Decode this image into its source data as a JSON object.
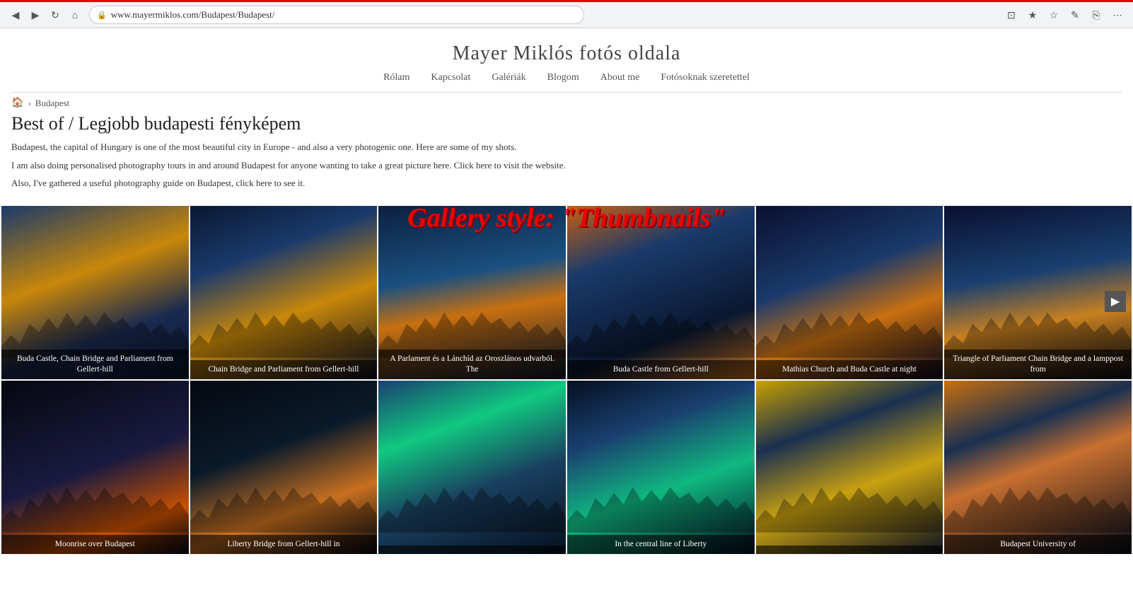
{
  "browser": {
    "url": "www.mayermiklos.com/Budapest/Budapest/",
    "back_label": "◀",
    "forward_label": "▶",
    "reload_label": "↻",
    "home_label": "⌂",
    "bookmark_label": "★",
    "star_label": "☆",
    "pen_label": "✎",
    "share_label": "⎘",
    "menu_label": "⋯"
  },
  "site": {
    "title": "Mayer Miklós fotós oldala",
    "nav": {
      "items": [
        {
          "label": "Rólam"
        },
        {
          "label": "Kapcsolat"
        },
        {
          "label": "Galériák"
        },
        {
          "label": "Blogom"
        },
        {
          "label": "About me"
        },
        {
          "label": "Fotósoknak szeretettel"
        }
      ]
    }
  },
  "breadcrumb": {
    "home_icon": "🏠",
    "separator": "›",
    "current": "Budapest"
  },
  "gallery_overlay": {
    "title": "Gallery style: \"Thumbnails\""
  },
  "page": {
    "heading": "Best of / Legjobb budapesti fényképem",
    "desc1": "Budapest, the capital of Hungary is one of the most beautiful city in Europe - and also a very photogenic one. Here are some of my shots.",
    "desc2": "I am also doing personalised photography tours in and around Budapest for anyone wanting to take a great picture here. Click here to visit the website.",
    "desc3": "Also, I've gathered a useful photography guide on Budapest, click here to see it."
  },
  "scroll_arrow": "▶",
  "gallery": {
    "items": [
      {
        "caption": "Buda Castle, Chain Bridge and Parliament from Gellert-hill",
        "photo_class": "photo-1"
      },
      {
        "caption": "Chain Bridge and Parliament from Gellert-hill",
        "photo_class": "photo-2"
      },
      {
        "caption": "A Parlament és a Lánchíd az Oroszlános udvarból. The",
        "photo_class": "photo-3"
      },
      {
        "caption": "Buda Castle from Gellert-hill",
        "photo_class": "photo-4"
      },
      {
        "caption": "Mathias Church and Buda Castle at night",
        "photo_class": "photo-5"
      },
      {
        "caption": "Triangle of Parliament Chain Bridge and a lamppost from",
        "photo_class": "photo-6"
      },
      {
        "caption": "Moonrise over Budapest",
        "photo_class": "photo-7"
      },
      {
        "caption": "Liberty Bridge from Gellert-hill in",
        "photo_class": "photo-8"
      },
      {
        "caption": "",
        "photo_class": "photo-9"
      },
      {
        "caption": "In the central line of Liberty",
        "photo_class": "photo-10"
      },
      {
        "caption": "",
        "photo_class": "photo-11"
      },
      {
        "caption": "Budapest University of",
        "photo_class": "photo-12"
      }
    ]
  }
}
